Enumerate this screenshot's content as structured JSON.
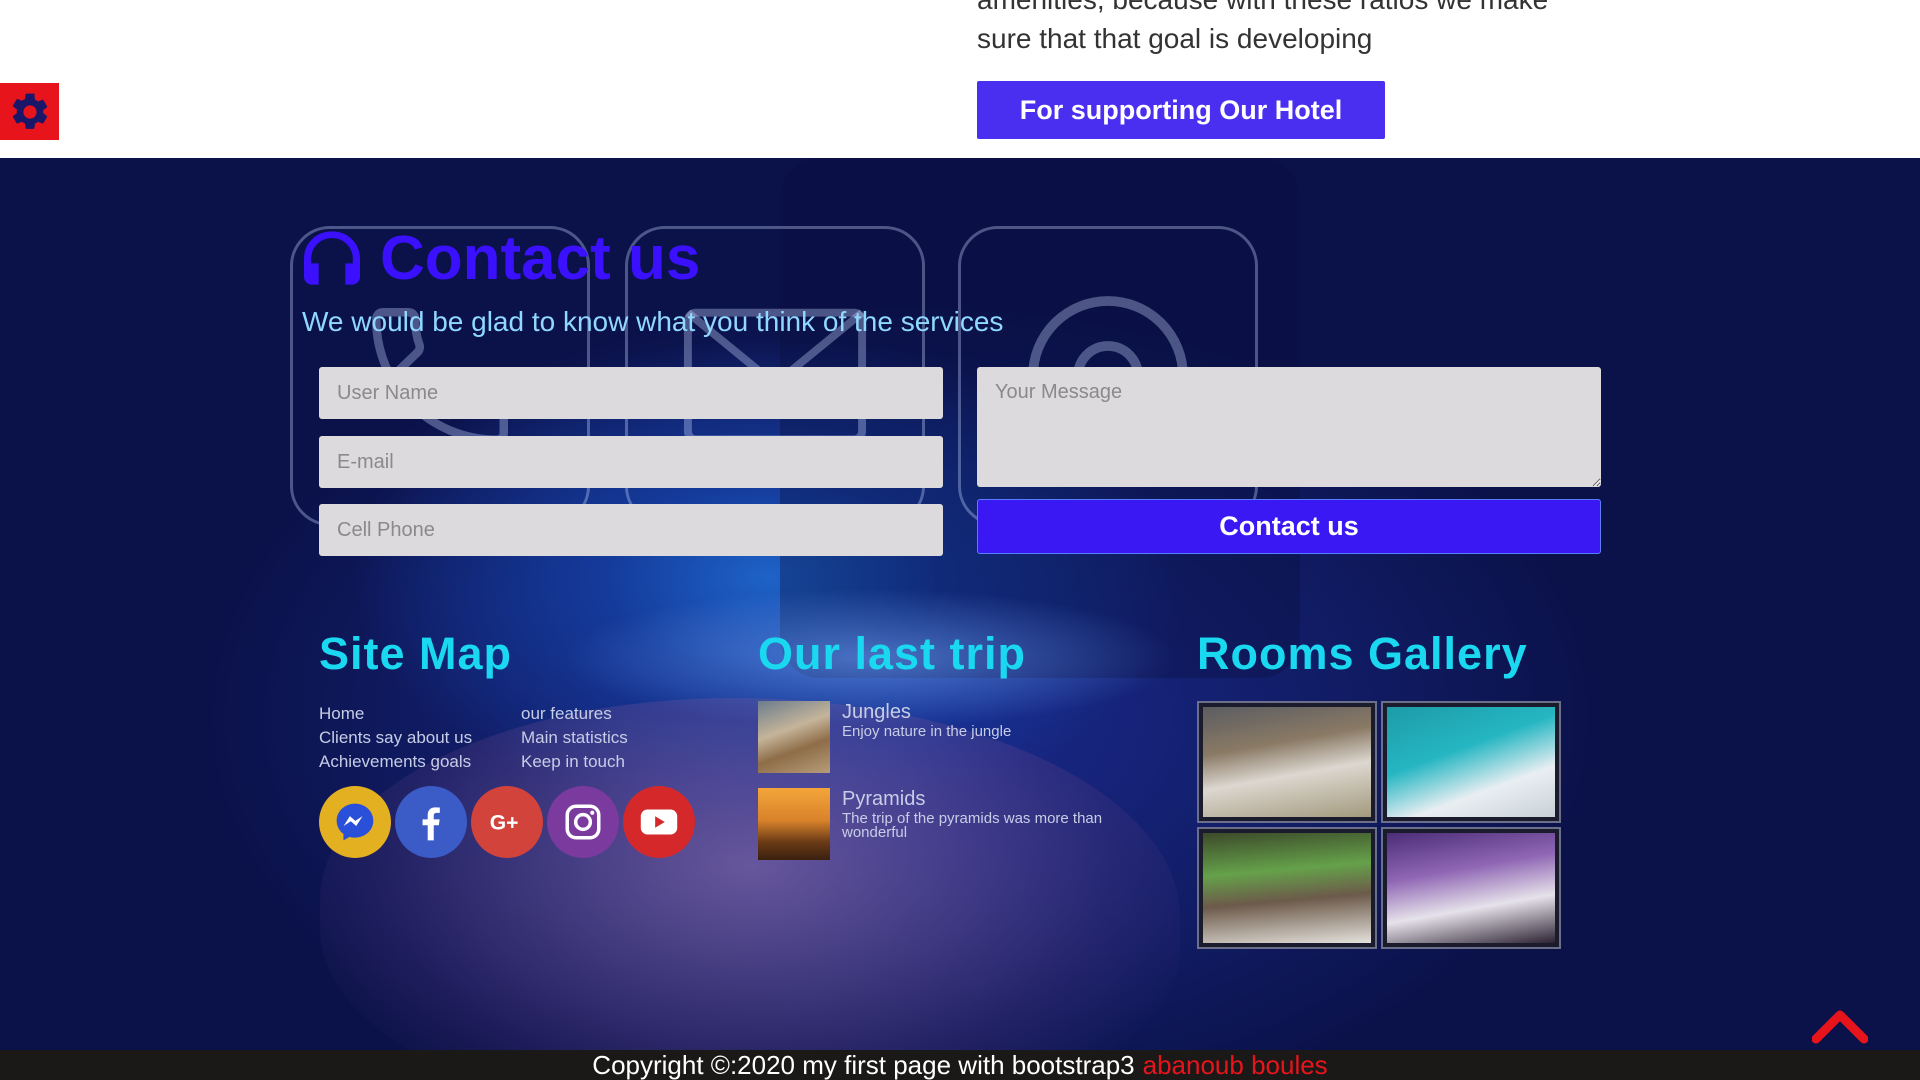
{
  "intro": {
    "text": "amenities, because with these ratios we make sure that that goal is developing"
  },
  "support_button": {
    "label": "For supporting Our Hotel"
  },
  "contact": {
    "title": "Contact us",
    "subtitle": "We would be glad to know what you think of the services",
    "username_placeholder": "User Name",
    "email_placeholder": "E-mail",
    "phone_placeholder": "Cell Phone",
    "message_placeholder": "Your Message",
    "submit_label": "Contact us"
  },
  "sitemap": {
    "title": "Site Map",
    "links": [
      "Home",
      "our features",
      "Clients say about us",
      "Main statistics",
      "Achievements goals",
      "Keep in touch"
    ]
  },
  "social": [
    "messenger-icon",
    "facebook-icon",
    "google-plus-icon",
    "instagram-icon",
    "youtube-icon"
  ],
  "trips": {
    "title": "Our last trip",
    "items": [
      {
        "name": "Jungles",
        "desc": "Enjoy nature in the jungle"
      },
      {
        "name": "Pyramids",
        "desc": "The trip of the pyramids was more than wonderful"
      }
    ]
  },
  "gallery": {
    "title": "Rooms Gallery"
  },
  "footer": {
    "copyright": "Copyright ©:2020 my first page with bootstrap3",
    "author": "abanoub boules"
  },
  "colors": {
    "accent": "#4b2ff0",
    "title_blue": "#3a10ff",
    "heading_cyan": "#1ad8f0",
    "red": "#e8141c"
  }
}
